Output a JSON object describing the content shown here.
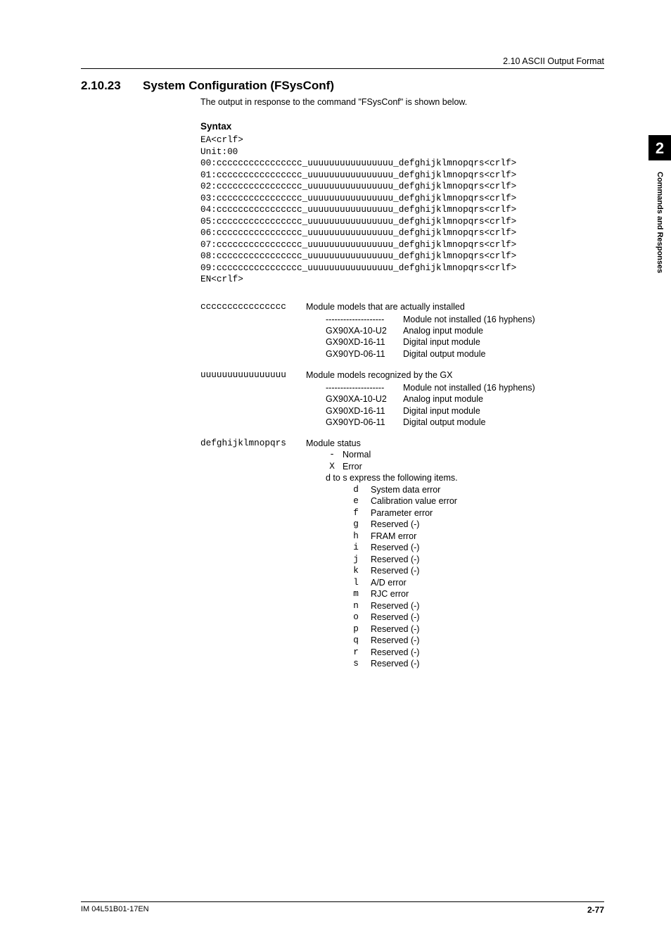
{
  "header": {
    "breadcrumb": "2.10  ASCII Output Format"
  },
  "section": {
    "number": "2.10.23",
    "title": "System Configuration (FSysConf)",
    "intro": "The output in response to the command \"FSysConf\" is shown below."
  },
  "syntax": {
    "heading": "Syntax",
    "lines": [
      "EA<crlf>",
      "Unit:00",
      "00:cccccccccccccccc_uuuuuuuuuuuuuuuu_defghijklmnopqrs<crlf>",
      "01:cccccccccccccccc_uuuuuuuuuuuuuuuu_defghijklmnopqrs<crlf>",
      "02:cccccccccccccccc_uuuuuuuuuuuuuuuu_defghijklmnopqrs<crlf>",
      "03:cccccccccccccccc_uuuuuuuuuuuuuuuu_defghijklmnopqrs<crlf>",
      "04:cccccccccccccccc_uuuuuuuuuuuuuuuu_defghijklmnopqrs<crlf>",
      "05:cccccccccccccccc_uuuuuuuuuuuuuuuu_defghijklmnopqrs<crlf>",
      "06:cccccccccccccccc_uuuuuuuuuuuuuuuu_defghijklmnopqrs<crlf>",
      "07:cccccccccccccccc_uuuuuuuuuuuuuuuu_defghijklmnopqrs<crlf>",
      "08:cccccccccccccccc_uuuuuuuuuuuuuuuu_defghijklmnopqrs<crlf>",
      "09:cccccccccccccccc_uuuuuuuuuuuuuuuu_defghijklmnopqrs<crlf>",
      "EN<crlf>"
    ]
  },
  "defs": [
    {
      "key": "cccccccccccccccc",
      "title": "Module models that are actually installed",
      "rows": [
        {
          "k": "--------------------",
          "v": "Module not installed (16 hyphens)"
        },
        {
          "k": "GX90XA-10-U2",
          "v": "Analog input module"
        },
        {
          "k": "GX90XD-16-11",
          "v": "Digital input module"
        },
        {
          "k": "GX90YD-06-11",
          "v": "Digital output module"
        }
      ]
    },
    {
      "key": "uuuuuuuuuuuuuuuu",
      "title": "Module models recognized by the GX",
      "rows": [
        {
          "k": "--------------------",
          "v": "Module not installed (16 hyphens)"
        },
        {
          "k": "GX90XA-10-U2",
          "v": "Analog input module"
        },
        {
          "k": "GX90XD-16-11",
          "v": "Digital input module"
        },
        {
          "k": "GX90YD-06-11",
          "v": "Digital output module"
        }
      ]
    }
  ],
  "status": {
    "key": "defghijklmnopqrs",
    "title": "Module status",
    "legend": [
      {
        "sym": "-",
        "lbl": "Normal"
      },
      {
        "sym": "X",
        "lbl": "Error"
      }
    ],
    "note": "d to s express the following items.",
    "chars": [
      {
        "sym": "d",
        "lbl": "System data error"
      },
      {
        "sym": "e",
        "lbl": "Calibration value error"
      },
      {
        "sym": "f",
        "lbl": "Parameter error"
      },
      {
        "sym": "g",
        "lbl": "Reserved (-)"
      },
      {
        "sym": "h",
        "lbl": "FRAM error"
      },
      {
        "sym": "i",
        "lbl": "Reserved (-)"
      },
      {
        "sym": "j",
        "lbl": "Reserved (-)"
      },
      {
        "sym": "k",
        "lbl": "Reserved (-)"
      },
      {
        "sym": "l",
        "lbl": "A/D error"
      },
      {
        "sym": "m",
        "lbl": "RJC error"
      },
      {
        "sym": "n",
        "lbl": "Reserved (-)"
      },
      {
        "sym": "o",
        "lbl": "Reserved (-)"
      },
      {
        "sym": "p",
        "lbl": "Reserved (-)"
      },
      {
        "sym": "q",
        "lbl": "Reserved (-)"
      },
      {
        "sym": "r",
        "lbl": "Reserved (-)"
      },
      {
        "sym": "s",
        "lbl": "Reserved (-)"
      }
    ]
  },
  "sidebar": {
    "chapter": "2",
    "label": "Commands and Responses"
  },
  "footer": {
    "left": "IM 04L51B01-17EN",
    "right": "2-77"
  }
}
